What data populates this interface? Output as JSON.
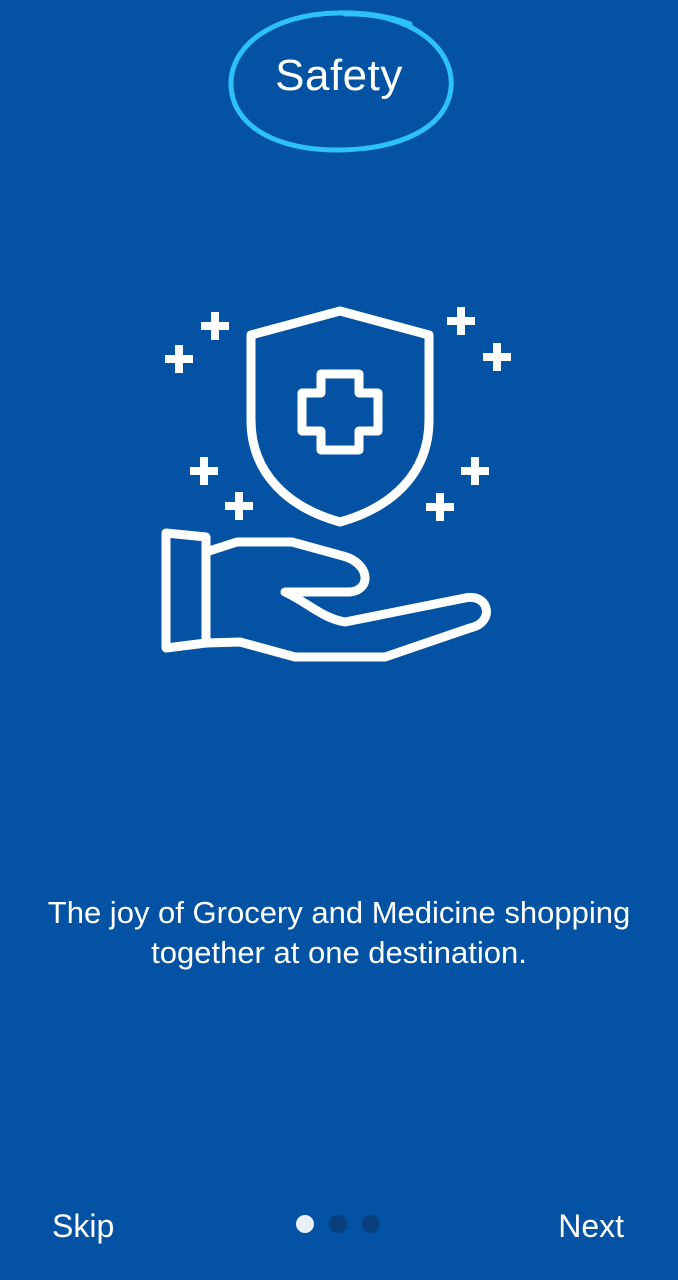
{
  "onboarding": {
    "title": "Safety",
    "tagline_line1": "The joy of Grocery and Medicine shopping",
    "tagline_line2": "together at one destination.",
    "illustration_icon": "hand-holding-medical-shield-icon",
    "skip_label": "Skip",
    "next_label": "Next",
    "pager": {
      "total_pages": 3,
      "current_page": 1
    }
  },
  "colors": {
    "background": "#0352a3",
    "text": "#ffffff",
    "title_highlight_ring": "#2cc2f7",
    "dot_active": "#e8f0fb",
    "dot_inactive": "#0a3f7d"
  }
}
